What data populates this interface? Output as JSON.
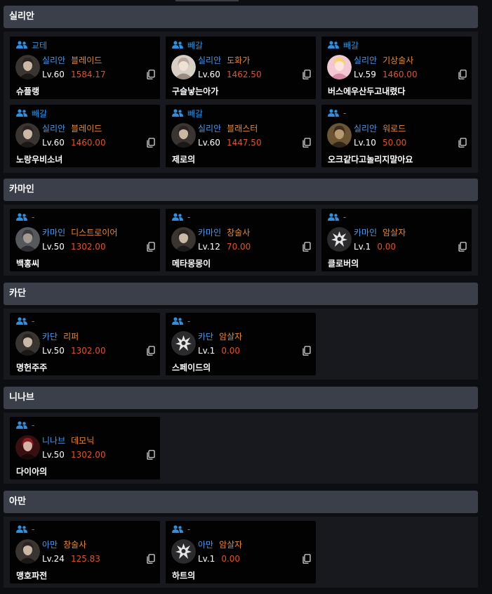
{
  "colors": {
    "party_blue": "#2f8fe0",
    "server_blue": "#4f96e8",
    "class_orange": "#e8883a",
    "itemlevel_red": "#e0552b",
    "header_bg": "#3b3f4a",
    "card_bg": "#020203"
  },
  "icons": {
    "party": "users-icon",
    "copy": "copy-icon",
    "avatar": "character-portrait"
  },
  "servers": [
    {
      "name": "실리안",
      "cards": [
        {
          "party": "교테",
          "server": "실리안",
          "class": "블레이드",
          "level": "Lv.60",
          "item_level": "1584.17",
          "name": "슈플랭"
        },
        {
          "party": "빼갈",
          "server": "실리안",
          "class": "도화가",
          "level": "Lv.60",
          "item_level": "1462.50",
          "name": "구슬낳는아가"
        },
        {
          "party": "빼갈",
          "server": "실리안",
          "class": "기상술사",
          "level": "Lv.59",
          "item_level": "1460.00",
          "name": "버스에우산두고내렸다"
        },
        {
          "party": "빼갈",
          "server": "실리안",
          "class": "블레이드",
          "level": "Lv.60",
          "item_level": "1460.00",
          "name": "노랑우비소녀"
        },
        {
          "party": "빼갈",
          "server": "실리안",
          "class": "블래스터",
          "level": "Lv.60",
          "item_level": "1447.50",
          "name": "제로의"
        },
        {
          "party": "-",
          "server": "실리안",
          "class": "워로드",
          "level": "Lv.10",
          "item_level": "50.00",
          "name": "오크같다고놀리지말아요"
        }
      ]
    },
    {
      "name": "카마인",
      "cards": [
        {
          "party": "-",
          "server": "카마인",
          "class": "디스트로이어",
          "level": "Lv.50",
          "item_level": "1302.00",
          "name": "백홍씨"
        },
        {
          "party": "-",
          "server": "카마인",
          "class": "창술사",
          "level": "Lv.12",
          "item_level": "70.00",
          "name": "메타몽몽이"
        },
        {
          "party": "-",
          "server": "카마인",
          "class": "암살자",
          "level": "Lv.1",
          "item_level": "0.00",
          "name": "클로버의"
        }
      ]
    },
    {
      "name": "카단",
      "cards": [
        {
          "party": "-",
          "server": "카단",
          "class": "리퍼",
          "level": "Lv.50",
          "item_level": "1302.00",
          "name": "명헌주주"
        },
        {
          "party": "-",
          "server": "카단",
          "class": "암살자",
          "level": "Lv.1",
          "item_level": "0.00",
          "name": "스페이드의"
        }
      ]
    },
    {
      "name": "니나브",
      "cards": [
        {
          "party": "-",
          "server": "니나브",
          "class": "데모닉",
          "level": "Lv.50",
          "item_level": "1302.00",
          "name": "다이아의"
        }
      ]
    },
    {
      "name": "아만",
      "cards": [
        {
          "party": "-",
          "server": "아만",
          "class": "창술사",
          "level": "Lv.24",
          "item_level": "125.83",
          "name": "맹호파전"
        },
        {
          "party": "-",
          "server": "아만",
          "class": "암살자",
          "level": "Lv.1",
          "item_level": "0.00",
          "name": "하트의"
        }
      ]
    }
  ]
}
